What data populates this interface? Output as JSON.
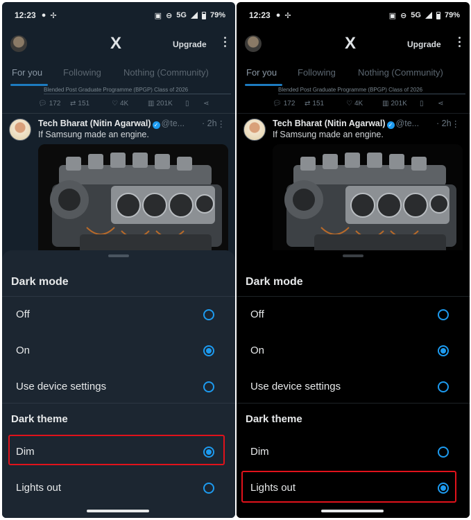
{
  "panels": [
    {
      "status": {
        "time": "12:23",
        "network": "5G",
        "battery": "79%"
      },
      "topbar": {
        "logo": "X",
        "upgrade_label": "Upgrade"
      },
      "tabs": [
        "For you",
        "Following",
        "Nothing (Community)"
      ],
      "promo_line": "Blended Post Graduate Programme (BPGP) Class of 2026",
      "actions": {
        "replies": "172",
        "reposts": "151",
        "likes": "4K",
        "views": "201K"
      },
      "post": {
        "author": "Tech Bharat (Nitin Agarwal)",
        "handle": "@te...",
        "time": "· 2h",
        "text": "If Samsung made an engine."
      },
      "sheet": {
        "dark_mode_title": "Dark mode",
        "dark_mode_options": [
          {
            "label": "Off",
            "selected": false
          },
          {
            "label": "On",
            "selected": true
          },
          {
            "label": "Use device settings",
            "selected": false
          }
        ],
        "dark_theme_title": "Dark theme",
        "dark_theme_options": [
          {
            "label": "Dim",
            "selected": true
          },
          {
            "label": "Lights out",
            "selected": false
          }
        ]
      }
    },
    {
      "status": {
        "time": "12:23",
        "network": "5G",
        "battery": "79%"
      },
      "topbar": {
        "logo": "X",
        "upgrade_label": "Upgrade"
      },
      "tabs": [
        "For you",
        "Following",
        "Nothing (Community)"
      ],
      "promo_line": "Blended Post Graduate Programme (BPGP) Class of 2026",
      "actions": {
        "replies": "172",
        "reposts": "151",
        "likes": "4K",
        "views": "201K"
      },
      "post": {
        "author": "Tech Bharat (Nitin Agarwal)",
        "handle": "@te...",
        "time": "· 2h",
        "text": "If Samsung made an engine."
      },
      "sheet": {
        "dark_mode_title": "Dark mode",
        "dark_mode_options": [
          {
            "label": "Off",
            "selected": false
          },
          {
            "label": "On",
            "selected": true
          },
          {
            "label": "Use device settings",
            "selected": false
          }
        ],
        "dark_theme_title": "Dark theme",
        "dark_theme_options": [
          {
            "label": "Dim",
            "selected": false
          },
          {
            "label": "Lights out",
            "selected": true
          }
        ]
      }
    }
  ],
  "colors": {
    "dim_bg": "#15202b",
    "lights_out_bg": "#000000",
    "accent": "#1d9bf0",
    "highlight": "#e1121b"
  }
}
